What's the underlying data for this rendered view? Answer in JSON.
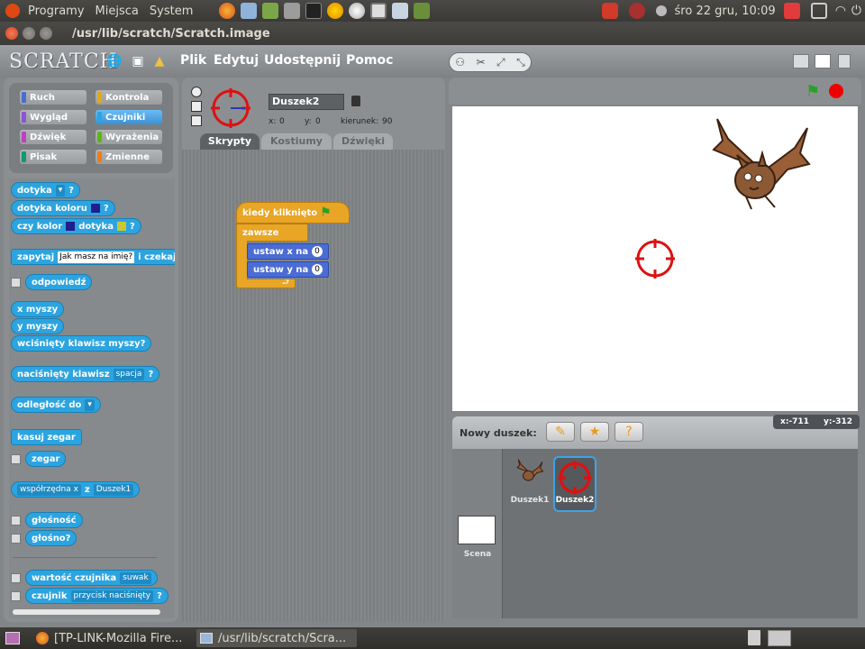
{
  "top_panel": {
    "menus": [
      "Programy",
      "Miejsca",
      "System"
    ],
    "clock": "śro 22 gru, 10:09"
  },
  "window": {
    "title": "/usr/lib/scratch/Scratch.image"
  },
  "menubar": {
    "logo": "SCRATCH",
    "items": [
      "Plik",
      "Edytuj",
      "Udostępnij",
      "Pomoc"
    ]
  },
  "categories": [
    {
      "label": "Ruch",
      "color": "#4a6cd4"
    },
    {
      "label": "Kontrola",
      "color": "#e1a91a"
    },
    {
      "label": "Wygląd",
      "color": "#8a55d7"
    },
    {
      "label": "Czujniki",
      "color": "#2ca4e0",
      "selected": true
    },
    {
      "label": "Dźwięk",
      "color": "#bb42c3"
    },
    {
      "label": "Wyrażenia",
      "color": "#5cb712"
    },
    {
      "label": "Pisak",
      "color": "#0e9a6c"
    },
    {
      "label": "Zmienne",
      "color": "#ee7d16"
    }
  ],
  "blocks": {
    "touching": "dotyka",
    "touching_color": "dotyka koloru",
    "color_touching_a": "czy kolor",
    "color_touching_b": "dotyka",
    "q": "?",
    "ask": "zapytaj",
    "ask_default": "Jak masz na imię?",
    "ask_wait": "i czekaj",
    "answer": "odpowiedź",
    "mouse_x": "x myszy",
    "mouse_y": "y myszy",
    "mouse_down": "wciśnięty klawisz myszy?",
    "key_pressed": "naciśnięty klawisz",
    "key_option": "spacja",
    "distance": "odległość do",
    "reset_timer": "kasuj zegar",
    "timer": "zegar",
    "attr_option": "współrzędna x",
    "attr_of": "z",
    "attr_sprite": "Duszek1",
    "loudness": "głośność",
    "loud": "głośno?",
    "sensor_value": "wartość czujnika",
    "sensor_value_option": "suwak",
    "sensor": "czujnik",
    "sensor_option": "przycisk naciśnięty"
  },
  "sprite": {
    "name": "Duszek2",
    "x_label": "x:",
    "x": "0",
    "y_label": "y:",
    "y": "0",
    "dir_label": "kierunek:",
    "direction": "90"
  },
  "tabs": [
    "Skrypty",
    "Kostiumy",
    "Dźwięki"
  ],
  "script": {
    "hat": "kiedy kliknięto",
    "forever": "zawsze",
    "set_x": "ustaw x na",
    "set_x_val": "0",
    "set_y": "ustaw y na",
    "set_y_val": "0"
  },
  "stage": {
    "mouse_x_label": "x:",
    "mouse_x": "-711",
    "mouse_y_label": "y:",
    "mouse_y": "-312"
  },
  "new_sprite": {
    "label": "Nowy duszek:"
  },
  "corral": {
    "stage_label": "Scena",
    "sprites": [
      "Duszek1",
      "Duszek2"
    ]
  },
  "taskbar": {
    "tasks": [
      "[TP-LINK-Mozilla Fire...",
      "/usr/lib/scratch/Scra..."
    ]
  }
}
